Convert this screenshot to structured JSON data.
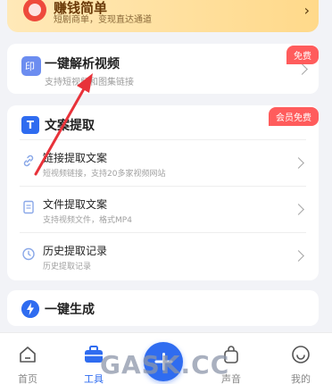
{
  "promo": {
    "title": "赚钱简单",
    "subtitle": "短剧商单，变现直达通道"
  },
  "parse_card": {
    "title": "一键解析视频",
    "subtitle": "支持短视频和图集链接",
    "badge": "免费"
  },
  "text_extract_card": {
    "title": "文案提取",
    "badge": "会员免费",
    "items": [
      {
        "title": "链接提取文案",
        "subtitle": "短视频链接，支持20多家视频网站",
        "icon": "link-icon"
      },
      {
        "title": "文件提取文案",
        "subtitle": "支持视频文件，格式MP4",
        "icon": "file-icon"
      },
      {
        "title": "历史提取记录",
        "subtitle": "历史提取记录",
        "icon": "clock-icon"
      }
    ]
  },
  "generate_card": {
    "title": "一键生成"
  },
  "tabbar": {
    "tabs": [
      {
        "label": "首页"
      },
      {
        "label": "工具"
      },
      {
        "label": "声音"
      },
      {
        "label": "我的"
      }
    ],
    "active": "工具"
  },
  "watermark": "GASK.CC",
  "colors": {
    "accent": "#2f6cf0",
    "badge": "#ff5c5c",
    "annotation_arrow": "#e8323a"
  }
}
